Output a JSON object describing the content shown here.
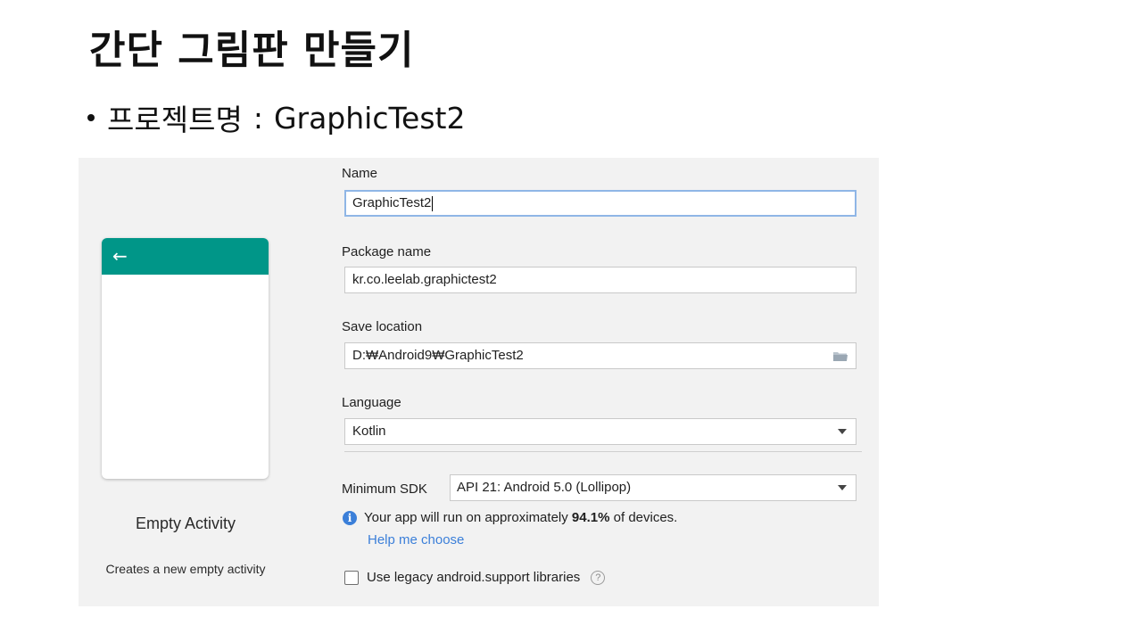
{
  "slide": {
    "title": "간단 그림판 만들기",
    "bullet_label": "프로젝트명",
    "bullet_sep": ":",
    "bullet_value": "GraphicTest2"
  },
  "preview": {
    "back_icon": "arrow-left-icon",
    "toolbar_color": "#009688",
    "activity_name": "Empty Activity",
    "activity_desc": "Creates a new empty activity"
  },
  "form": {
    "name_label": "Name",
    "name_value": "GraphicTest2",
    "package_label": "Package name",
    "package_value": "kr.co.leelab.graphictest2",
    "save_label": "Save location",
    "save_value": "D:₩Android9₩GraphicTest2",
    "language_label": "Language",
    "language_value": "Kotlin",
    "sdk_label": "Minimum SDK",
    "sdk_value": "API 21: Android 5.0 (Lollipop)",
    "info_prefix": "Your app will run on approximately",
    "info_percent": "94.1%",
    "info_suffix": "of devices.",
    "help_link": "Help me choose",
    "legacy_label": "Use legacy android.support libraries",
    "legacy_checked": false
  },
  "colors": {
    "accent": "#009688",
    "link": "#3b7fd9",
    "focus_border": "#8fb6e6"
  }
}
